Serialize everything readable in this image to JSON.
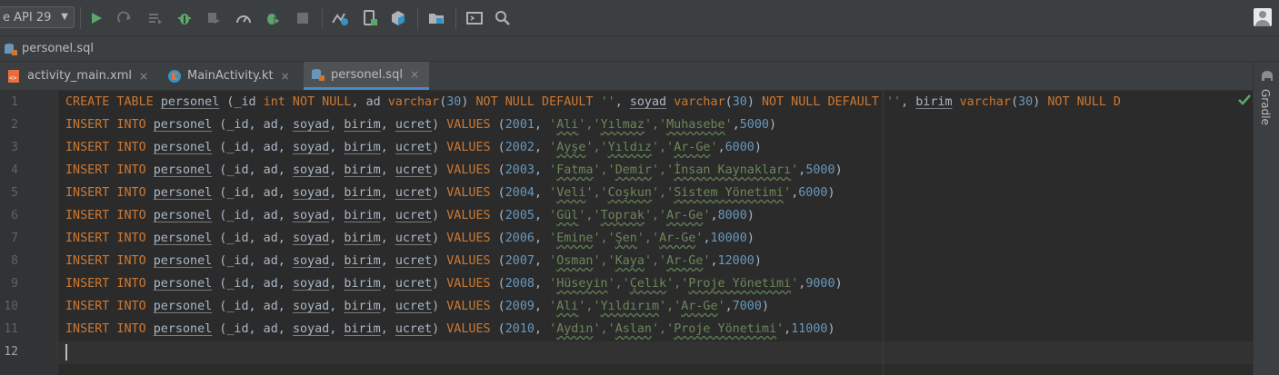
{
  "toolbar": {
    "device_label": "e API 29",
    "icons": [
      "run-icon",
      "apply-changes-icon",
      "apply-code-changes-icon",
      "debug-icon",
      "attach-debugger-icon",
      "profile-icon",
      "run-tests-icon",
      "stop-icon",
      "sync-gradle-icon",
      "avd-manager-icon",
      "sdk-manager-icon",
      "project-structure-icon",
      "terminal-icon",
      "search-icon"
    ]
  },
  "breadcrumb": {
    "file": "personel.sql"
  },
  "tabs": [
    {
      "label": "activity_main.xml",
      "icon": "xml-file-icon",
      "active": false
    },
    {
      "label": "MainActivity.kt",
      "icon": "kotlin-file-icon",
      "active": false
    },
    {
      "label": "personel.sql",
      "icon": "sql-file-icon",
      "active": true
    }
  ],
  "tab_close_glyph": "×",
  "right_panel": {
    "label": "Gradle"
  },
  "editor": {
    "current_line": 12,
    "line_numbers": [
      "1",
      "2",
      "3",
      "4",
      "5",
      "6",
      "7",
      "8",
      "9",
      "10",
      "11",
      "12"
    ],
    "create_line": {
      "parts": [
        [
          "kw",
          "CREATE TABLE "
        ],
        [
          "ut",
          "personel"
        ],
        [
          "plain",
          " (_id "
        ],
        [
          "kw",
          "int NOT NULL"
        ],
        [
          "plain",
          ", ad "
        ],
        [
          "kw",
          "varchar"
        ],
        [
          "plain",
          "("
        ],
        [
          "num",
          "30"
        ],
        [
          "plain",
          ") "
        ],
        [
          "kw",
          "NOT NULL DEFAULT "
        ],
        [
          "str",
          "''"
        ],
        [
          "plain",
          ", "
        ],
        [
          "ut",
          "soyad"
        ],
        [
          "plain",
          " "
        ],
        [
          "kw",
          "varchar"
        ],
        [
          "plain",
          "("
        ],
        [
          "num",
          "30"
        ],
        [
          "plain",
          ") "
        ],
        [
          "kw",
          "NOT NULL DEFAULT "
        ],
        [
          "str",
          "''"
        ],
        [
          "plain",
          ", "
        ],
        [
          "ut",
          "birim"
        ],
        [
          "plain",
          " "
        ],
        [
          "kw",
          "varchar"
        ],
        [
          "plain",
          "("
        ],
        [
          "num",
          "30"
        ],
        [
          "plain",
          ") "
        ],
        [
          "kw",
          "NOT NULL D"
        ]
      ]
    },
    "insert_rows": [
      {
        "id": "2001",
        "ad": "Ali",
        "soyad": "Yılmaz",
        "birim": "Muhasebe",
        "ucret": "5000"
      },
      {
        "id": "2002",
        "ad": "Ayşe",
        "soyad": "Yıldız",
        "birim": "Ar-Ge",
        "ucret": "6000"
      },
      {
        "id": "2003",
        "ad": "Fatma",
        "soyad": "Demir",
        "birim": "İnsan Kaynakları",
        "ucret": "5000"
      },
      {
        "id": "2004",
        "ad": "Veli",
        "soyad": "Coşkun",
        "birim": "Sistem Yönetimi",
        "ucret": "6000"
      },
      {
        "id": "2005",
        "ad": "Gül",
        "soyad": "Toprak",
        "birim": "Ar-Ge",
        "ucret": "8000"
      },
      {
        "id": "2006",
        "ad": "Emine",
        "soyad": "Şen",
        "birim": "Ar-Ge",
        "ucret": "10000"
      },
      {
        "id": "2007",
        "ad": "Osman",
        "soyad": "Kaya",
        "birim": "Ar-Ge",
        "ucret": "12000"
      },
      {
        "id": "2008",
        "ad": "Hüseyin",
        "soyad": "Çelik",
        "birim": "Proje Yönetimi",
        "ucret": "9000"
      },
      {
        "id": "2009",
        "ad": "Ali",
        "soyad": "Yıldırım",
        "birim": "Ar-Ge",
        "ucret": "7000"
      },
      {
        "id": "2010",
        "ad": "Aydın",
        "soyad": "Aslan",
        "birim": "Proje Yönetimi",
        "ucret": "11000"
      }
    ],
    "insert_tokens": {
      "insert_into": "INSERT INTO ",
      "table": "personel",
      "col_id": " (_id, ad, ",
      "col_soyad": "soyad",
      "sep1": ", ",
      "col_birim": "birim",
      "sep2": ", ",
      "col_ucret": "ucret",
      "close_cols": ") ",
      "values_kw": "VALUES",
      "open_vals": " ("
    }
  },
  "colors": {
    "keyword": "#cc7832",
    "string": "#6a8759",
    "number": "#6897bb",
    "identifier": "#a9b7c6",
    "active_tab_underline": "#4a88c7",
    "run_green": "#59a869"
  }
}
